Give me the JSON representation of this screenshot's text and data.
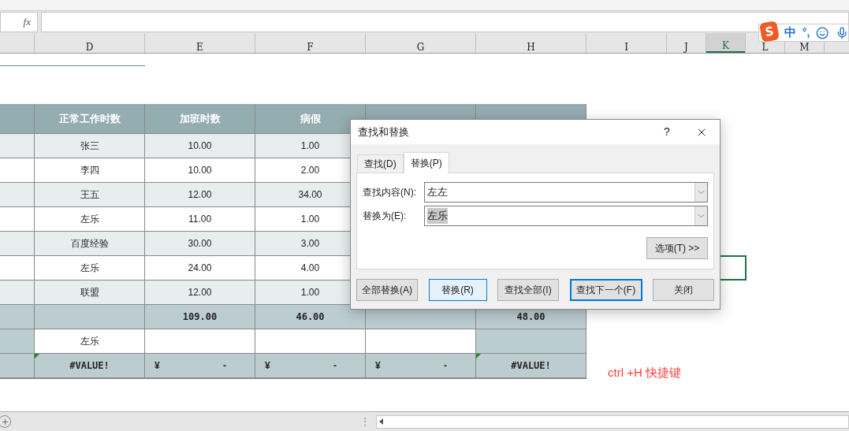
{
  "formula_bar": {
    "fx": "fx"
  },
  "column_headers": [
    {
      "label": "D",
      "selected": false
    },
    {
      "label": "E",
      "selected": false
    },
    {
      "label": "F",
      "selected": false
    },
    {
      "label": "G",
      "selected": false
    },
    {
      "label": "H",
      "selected": false
    },
    {
      "label": "I",
      "selected": false
    },
    {
      "label": "J",
      "selected": false
    },
    {
      "label": "K",
      "selected": true
    },
    {
      "label": "L",
      "selected": false
    },
    {
      "label": "M",
      "selected": false
    }
  ],
  "ime_toolbar": {
    "mode": "中",
    "punctuation": "°,"
  },
  "table": {
    "columns": [
      {
        "header": "正常工作时数"
      },
      {
        "header": "加班时数"
      },
      {
        "header": "病假"
      },
      {},
      {}
    ],
    "rows": [
      {
        "kind": "light",
        "cells": [
          {
            "text": "张三"
          },
          {
            "text": "10.00"
          },
          {
            "text": "1.00"
          },
          null,
          null
        ]
      },
      {
        "kind": "white",
        "cells": [
          {
            "text": "李四"
          },
          {
            "text": "10.00"
          },
          {
            "text": "2.00"
          },
          null,
          null
        ]
      },
      {
        "kind": "light",
        "cells": [
          {
            "text": "王五"
          },
          {
            "text": "12.00"
          },
          {
            "text": "34.00"
          },
          null,
          null
        ]
      },
      {
        "kind": "white",
        "cells": [
          {
            "text": "左乐"
          },
          {
            "text": "11.00"
          },
          {
            "text": "1.00"
          },
          null,
          null
        ]
      },
      {
        "kind": "light",
        "cells": [
          {
            "text": "百度经验"
          },
          {
            "text": "30.00"
          },
          {
            "text": "3.00"
          },
          null,
          null
        ]
      },
      {
        "kind": "white",
        "cells": [
          {
            "text": "左乐"
          },
          {
            "text": "24.00"
          },
          {
            "text": "4.00"
          },
          null,
          null
        ]
      },
      {
        "kind": "light",
        "cells": [
          {
            "text": "联盟"
          },
          {
            "text": "12.00"
          },
          {
            "text": "1.00"
          },
          null,
          null
        ]
      },
      {
        "kind": "total",
        "cells": [
          null,
          {
            "text": "109.00"
          },
          {
            "text": "46.00"
          },
          null,
          {
            "text": "48.00"
          }
        ]
      },
      {
        "kind": "name",
        "cells": [
          {
            "text": "左乐"
          },
          null,
          null,
          null,
          null
        ]
      },
      {
        "kind": "total",
        "cells": [
          {
            "text": "#VALUE!",
            "error": true
          },
          {
            "left": "¥",
            "right": "-"
          },
          {
            "left": "¥",
            "right": "-"
          },
          {
            "left": "¥",
            "right": "-"
          },
          {
            "text": "#VALUE!",
            "error": true
          }
        ]
      }
    ]
  },
  "note": "ctrl +H 快捷键",
  "dialog": {
    "title": "查找和替换",
    "help": "?",
    "tabs": [
      {
        "label": "查找(D)",
        "selected": false
      },
      {
        "label": "替换(P)",
        "selected": true
      }
    ],
    "fields": [
      {
        "label": "查找内容(N):",
        "value": "左左",
        "selected": false
      },
      {
        "label": "替换为(E):",
        "value": "左乐",
        "selected": true
      }
    ],
    "options_button": "选项(T) >>",
    "buttons": [
      {
        "label": "全部替换(A)",
        "hovered": false,
        "default": false
      },
      {
        "label": "替换(R)",
        "hovered": true,
        "default": false
      },
      {
        "label": "查找全部(I)",
        "hovered": false,
        "default": false
      },
      {
        "label": "查找下一个(F)",
        "hovered": false,
        "default": true
      },
      {
        "label": "关闭",
        "hovered": false,
        "default": false
      }
    ]
  },
  "status_bar": {
    "handle": "⋮"
  }
}
